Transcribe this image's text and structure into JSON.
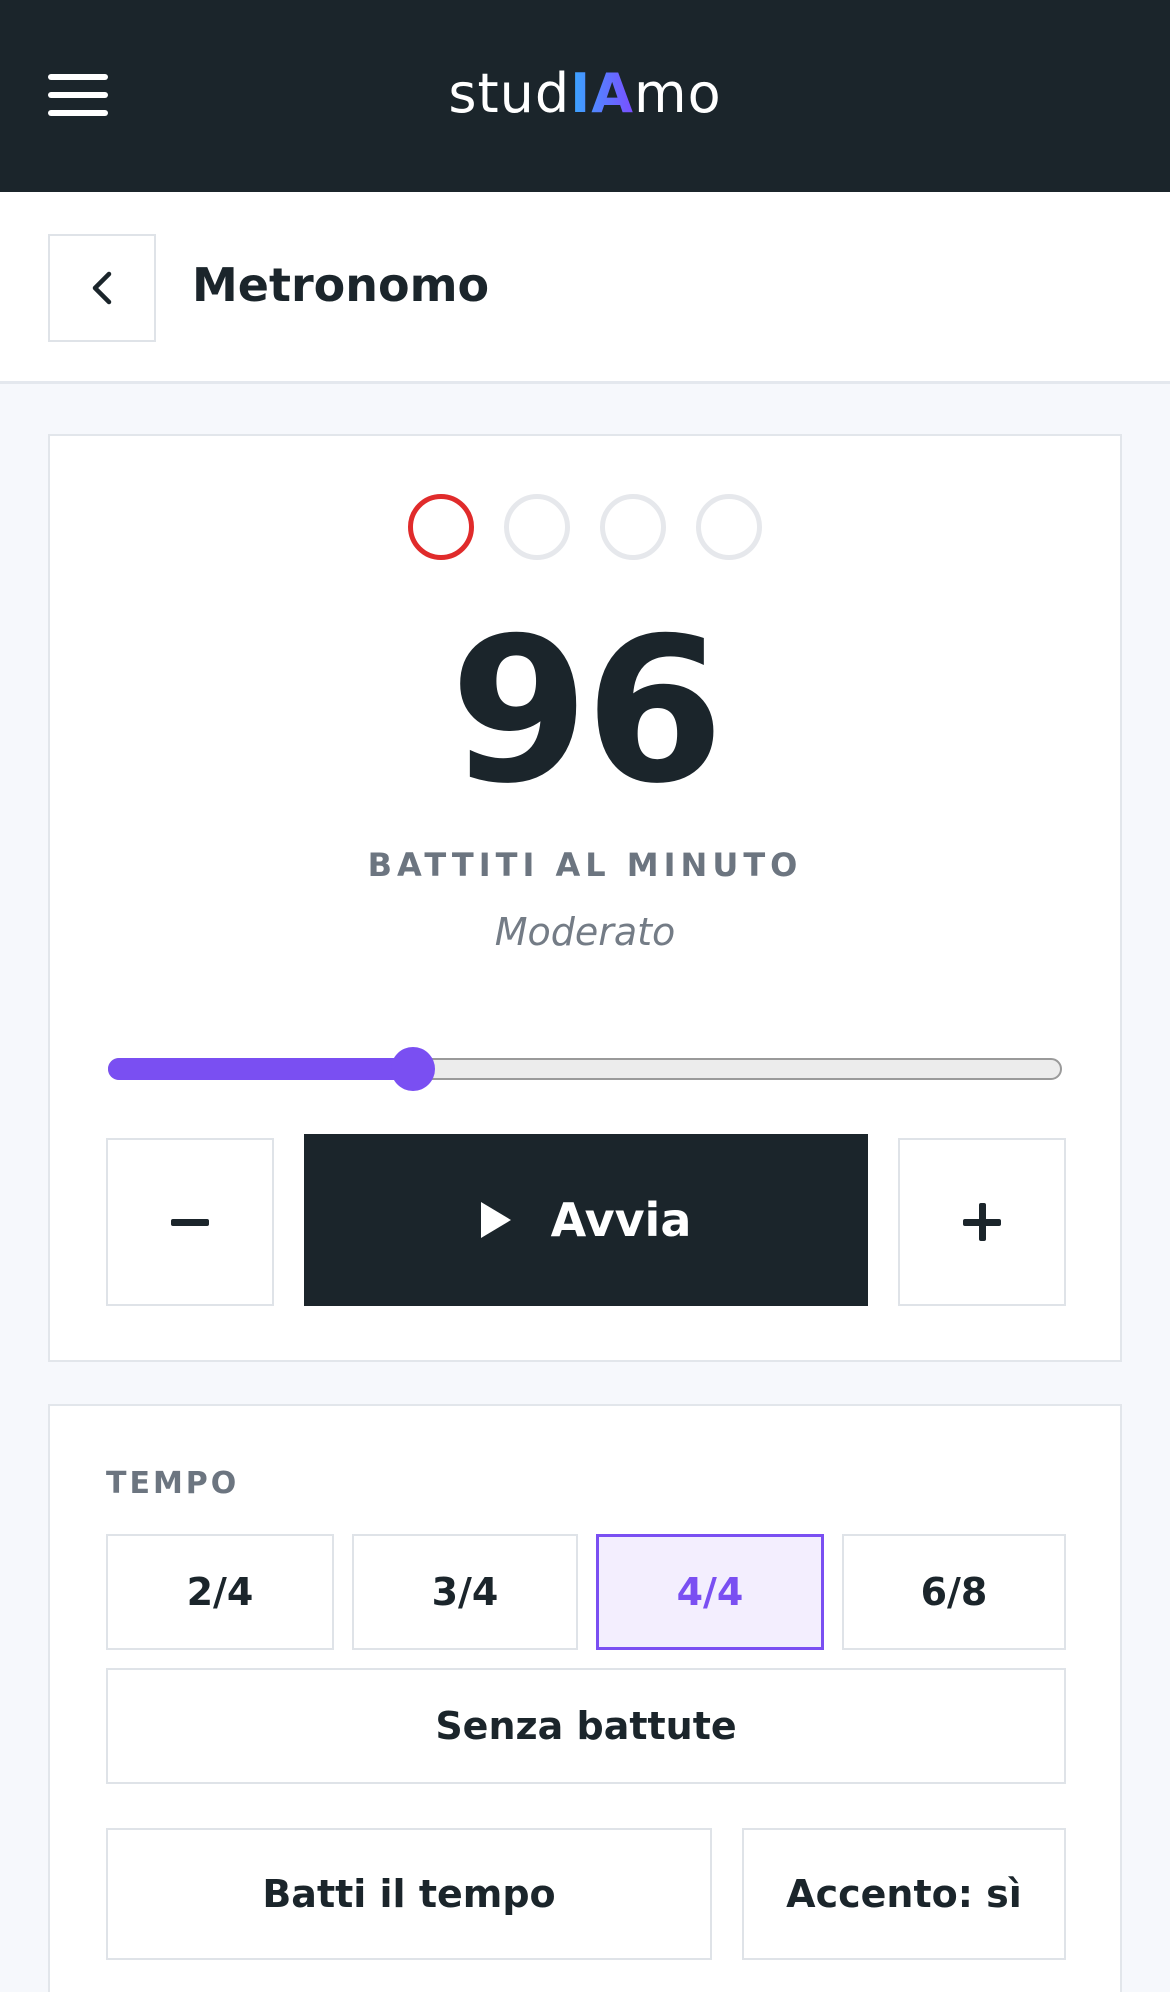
{
  "header": {
    "logo_pre": "stud",
    "logo_ia": "IA",
    "logo_post": "mo",
    "menu_icon": "hamburger-icon"
  },
  "titlebar": {
    "back_icon": "chevron-left-icon",
    "title": "Metronomo"
  },
  "metronome": {
    "beats_per_bar": 4,
    "active_beat": 1,
    "bpm": "96",
    "bpm_label": "BATTITI AL MINUTO",
    "tempo_name": "Moderato",
    "slider_fraction": 0.32,
    "decrement_icon": "minus-icon",
    "increment_icon": "plus-icon",
    "start_icon": "play-icon",
    "start_label": "Avvia"
  },
  "settings": {
    "section_label": "TEMPO",
    "time_signatures": [
      "2/4",
      "3/4",
      "4/4",
      "6/8"
    ],
    "selected_signature": "4/4",
    "no_bars_label": "Senza battute",
    "tap_label": "Batti il tempo",
    "accent_label": "Accento: sì"
  },
  "colors": {
    "header_bg": "#1b252b",
    "accent": "#7a4ff2",
    "active_beat": "#e02b2b",
    "page_bg": "#f6f8fc"
  }
}
